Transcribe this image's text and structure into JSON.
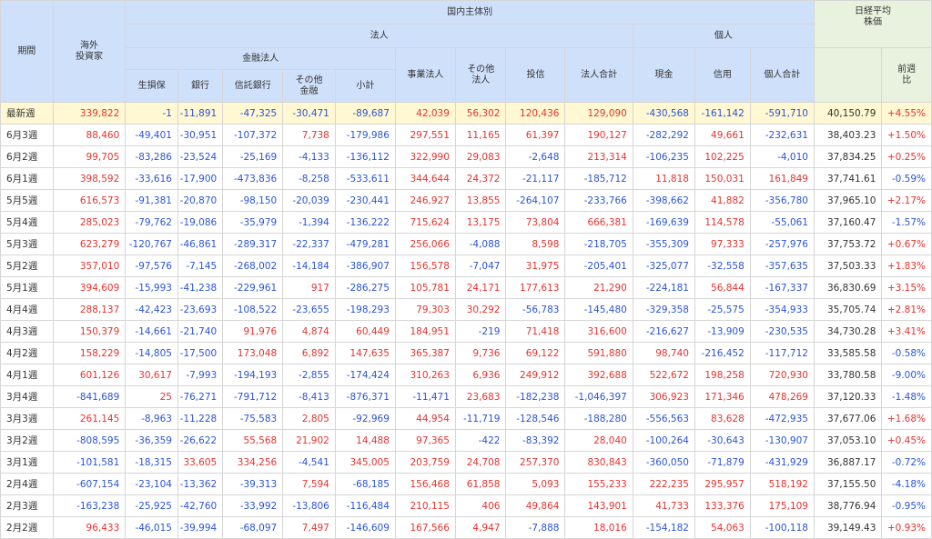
{
  "header": {
    "period": "期間",
    "foreign": "海外\n投資家",
    "domestic": "国内主体別",
    "corp": "法人",
    "individual": "個人",
    "financial": "金融法人",
    "nikkei": "日経平均\n株価",
    "cols": {
      "insurance": "生損保",
      "bank": "銀行",
      "trust": "信託銀行",
      "other_fin": "その他\n金融",
      "subtotal": "小計",
      "business": "事業法人",
      "other_corp": "その他\n法人",
      "invtrust": "投信",
      "corp_total": "法人合計",
      "cash": "現金",
      "credit": "信用",
      "ind_total": "個人合計",
      "wow": "前週\n比"
    }
  },
  "rows": [
    {
      "period": "最新週",
      "values": [
        "339,822",
        "-1",
        "-11,891",
        "-47,325",
        "-30,471",
        "-89,687",
        "42,039",
        "56,302",
        "120,436",
        "129,090",
        "-430,568",
        "-161,142",
        "-591,710"
      ],
      "price": "40,150.79",
      "wow": "+4.55%"
    },
    {
      "period": "6月3週",
      "values": [
        "88,460",
        "-49,401",
        "-30,951",
        "-107,372",
        "7,738",
        "-179,986",
        "297,551",
        "11,165",
        "61,397",
        "190,127",
        "-282,292",
        "49,661",
        "-232,631"
      ],
      "price": "38,403.23",
      "wow": "+1.50%"
    },
    {
      "period": "6月2週",
      "values": [
        "99,705",
        "-83,286",
        "-23,524",
        "-25,169",
        "-4,133",
        "-136,112",
        "322,990",
        "29,083",
        "-2,648",
        "213,314",
        "-106,235",
        "102,225",
        "-4,010"
      ],
      "price": "37,834.25",
      "wow": "+0.25%"
    },
    {
      "period": "6月1週",
      "values": [
        "398,592",
        "-33,616",
        "-17,900",
        "-473,836",
        "-8,258",
        "-533,611",
        "344,644",
        "24,372",
        "-21,117",
        "-185,712",
        "11,818",
        "150,031",
        "161,849"
      ],
      "price": "37,741.61",
      "wow": "-0.59%"
    },
    {
      "period": "5月5週",
      "values": [
        "616,573",
        "-91,381",
        "-20,870",
        "-98,150",
        "-20,039",
        "-230,441",
        "246,927",
        "13,855",
        "-264,107",
        "-233,766",
        "-398,662",
        "41,882",
        "-356,780"
      ],
      "price": "37,965.10",
      "wow": "+2.17%"
    },
    {
      "period": "5月4週",
      "values": [
        "285,023",
        "-79,762",
        "-19,086",
        "-35,979",
        "-1,394",
        "-136,222",
        "715,624",
        "13,175",
        "73,804",
        "666,381",
        "-169,639",
        "114,578",
        "-55,061"
      ],
      "price": "37,160.47",
      "wow": "-1.57%"
    },
    {
      "period": "5月3週",
      "values": [
        "623,279",
        "-120,767",
        "-46,861",
        "-289,317",
        "-22,337",
        "-479,281",
        "256,066",
        "-4,088",
        "8,598",
        "-218,705",
        "-355,309",
        "97,333",
        "-257,976"
      ],
      "price": "37,753.72",
      "wow": "+0.67%"
    },
    {
      "period": "5月2週",
      "values": [
        "357,010",
        "-97,576",
        "-7,145",
        "-268,002",
        "-14,184",
        "-386,907",
        "156,578",
        "-7,047",
        "31,975",
        "-205,401",
        "-325,077",
        "-32,558",
        "-357,635"
      ],
      "price": "37,503.33",
      "wow": "+1.83%"
    },
    {
      "period": "5月1週",
      "values": [
        "394,609",
        "-15,993",
        "-41,238",
        "-229,961",
        "917",
        "-286,275",
        "105,781",
        "24,171",
        "177,613",
        "21,290",
        "-224,181",
        "56,844",
        "-167,337"
      ],
      "price": "36,830.69",
      "wow": "+3.15%"
    },
    {
      "period": "4月4週",
      "values": [
        "288,137",
        "-42,423",
        "-23,693",
        "-108,522",
        "-23,655",
        "-198,293",
        "79,303",
        "30,292",
        "-56,783",
        "-145,480",
        "-329,358",
        "-25,575",
        "-354,933"
      ],
      "price": "35,705.74",
      "wow": "+2.81%"
    },
    {
      "period": "4月3週",
      "values": [
        "150,379",
        "-14,661",
        "-21,740",
        "91,976",
        "4,874",
        "60,449",
        "184,951",
        "-219",
        "71,418",
        "316,600",
        "-216,627",
        "-13,909",
        "-230,535"
      ],
      "price": "34,730.28",
      "wow": "+3.41%"
    },
    {
      "period": "4月2週",
      "values": [
        "158,229",
        "-14,805",
        "-17,500",
        "173,048",
        "6,892",
        "147,635",
        "365,387",
        "9,736",
        "69,122",
        "591,880",
        "98,740",
        "-216,452",
        "-117,712"
      ],
      "price": "33,585.58",
      "wow": "-0.58%"
    },
    {
      "period": "4月1週",
      "values": [
        "601,126",
        "30,617",
        "-7,993",
        "-194,193",
        "-2,855",
        "-174,424",
        "310,263",
        "6,936",
        "249,912",
        "392,688",
        "522,672",
        "198,258",
        "720,930"
      ],
      "price": "33,780.58",
      "wow": "-9.00%"
    },
    {
      "period": "3月4週",
      "values": [
        "-841,689",
        "25",
        "-76,271",
        "-791,712",
        "-8,413",
        "-876,371",
        "-11,471",
        "23,683",
        "-182,238",
        "-1,046,397",
        "306,923",
        "171,346",
        "478,269"
      ],
      "price": "37,120.33",
      "wow": "-1.48%"
    },
    {
      "period": "3月3週",
      "values": [
        "261,145",
        "-8,963",
        "-11,228",
        "-75,583",
        "2,805",
        "-92,969",
        "44,954",
        "-11,719",
        "-128,546",
        "-188,280",
        "-556,563",
        "83,628",
        "-472,935"
      ],
      "price": "37,677.06",
      "wow": "+1.68%"
    },
    {
      "period": "3月2週",
      "values": [
        "-808,595",
        "-36,359",
        "-26,622",
        "55,568",
        "21,902",
        "14,488",
        "97,365",
        "-422",
        "-83,392",
        "28,040",
        "-100,264",
        "-30,643",
        "-130,907"
      ],
      "price": "37,053.10",
      "wow": "+0.45%"
    },
    {
      "period": "3月1週",
      "values": [
        "-101,581",
        "-18,315",
        "33,605",
        "334,256",
        "-4,541",
        "345,005",
        "203,759",
        "24,708",
        "257,370",
        "830,843",
        "-360,050",
        "-71,879",
        "-431,929"
      ],
      "price": "36,887.17",
      "wow": "-0.72%"
    },
    {
      "period": "2月4週",
      "values": [
        "-607,154",
        "-23,104",
        "-13,362",
        "-39,313",
        "7,594",
        "-68,185",
        "156,468",
        "61,858",
        "5,093",
        "155,233",
        "222,235",
        "295,957",
        "518,192"
      ],
      "price": "37,155.50",
      "wow": "-4.18%"
    },
    {
      "period": "2月3週",
      "values": [
        "-163,238",
        "-25,925",
        "-42,760",
        "-33,992",
        "-13,806",
        "-116,484",
        "210,115",
        "406",
        "49,864",
        "143,901",
        "41,733",
        "133,376",
        "175,109"
      ],
      "price": "38,776.94",
      "wow": "-0.95%"
    },
    {
      "period": "2月2週",
      "values": [
        "96,433",
        "-46,015",
        "-39,994",
        "-68,097",
        "7,497",
        "-146,609",
        "167,566",
        "4,947",
        "-7,888",
        "18,016",
        "-154,182",
        "54,063",
        "-100,118"
      ],
      "price": "39,149.43",
      "wow": "+0.93%"
    }
  ],
  "colors": {
    "positive": "#e8322d",
    "negative": "#2a54d6",
    "header_blue": "#cfe0fb",
    "header_green": "#e8f2de",
    "latest_row": "#fff8d2"
  }
}
